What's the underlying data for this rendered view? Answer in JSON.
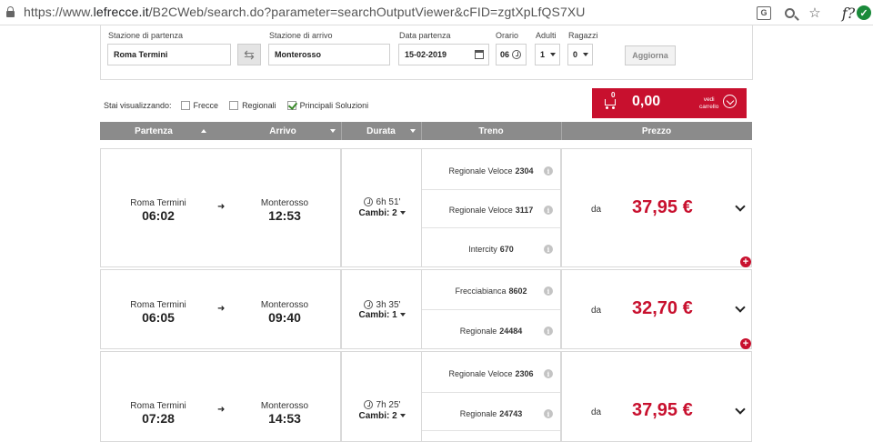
{
  "browser": {
    "url_scheme": "https://www.",
    "url_host": "lefrecce.it",
    "url_path": "/B2CWeb/search.do?parameter=searchOutputViewer&cFID=zgtXpLfQS7XU",
    "translate_glyph": "G",
    "ext_label": "f?",
    "ext_icon": "✓"
  },
  "search": {
    "departure_label": "Stazione di partenza",
    "departure_value": "Roma Termini",
    "arrival_label": "Stazione di arrivo",
    "arrival_value": "Monterosso",
    "date_label": "Data partenza",
    "date_value": "15-02-2019",
    "time_label": "Orario",
    "time_value": "06",
    "adults_label": "Adulti",
    "adults_value": "1",
    "children_label": "Ragazzi",
    "children_value": "0",
    "update_button": "Aggiorna"
  },
  "filters": {
    "label": "Stai visualizzando:",
    "options": [
      {
        "label": "Frecce",
        "checked": false
      },
      {
        "label": "Regionali",
        "checked": false
      },
      {
        "label": "Principali Soluzioni",
        "checked": true
      }
    ]
  },
  "cart": {
    "count": "0",
    "amount": "0,00",
    "label_line1": "vedi",
    "label_line2": "carrello",
    "color": "#c8102e"
  },
  "table": {
    "headers": {
      "departure": "Partenza",
      "arrival": "Arrivo",
      "duration": "Durata",
      "train": "Treno",
      "price": "Prezzo"
    },
    "price_prefix": "da",
    "rows": [
      {
        "from": "Roma Termini",
        "dep_time": "06:02",
        "to": "Monterosso",
        "arr_time": "12:53",
        "duration": "6h 51'",
        "changes": "Cambi: 2",
        "trains": [
          {
            "type": "Regionale Veloce",
            "number": "2304"
          },
          {
            "type": "Regionale Veloce",
            "number": "3117"
          },
          {
            "type": "Intercity",
            "number": "670"
          }
        ],
        "price": "37,95 €"
      },
      {
        "from": "Roma Termini",
        "dep_time": "06:05",
        "to": "Monterosso",
        "arr_time": "09:40",
        "duration": "3h 35'",
        "changes": "Cambi: 1",
        "trains": [
          {
            "type": "Frecciabianca",
            "number": "8602"
          },
          {
            "type": "Regionale",
            "number": "24484"
          }
        ],
        "price": "32,70 €"
      },
      {
        "from": "Roma Termini",
        "dep_time": "07:28",
        "to": "Monterosso",
        "arr_time": "14:53",
        "duration": "7h 25'",
        "changes": "Cambi: 2",
        "trains": [
          {
            "type": "Regionale Veloce",
            "number": "2306"
          },
          {
            "type": "Regionale",
            "number": "24743"
          }
        ],
        "price": "37,95 €"
      }
    ]
  },
  "icons": {
    "info": "i",
    "plus": "+",
    "swap": "⇆",
    "arrow": "➜"
  }
}
